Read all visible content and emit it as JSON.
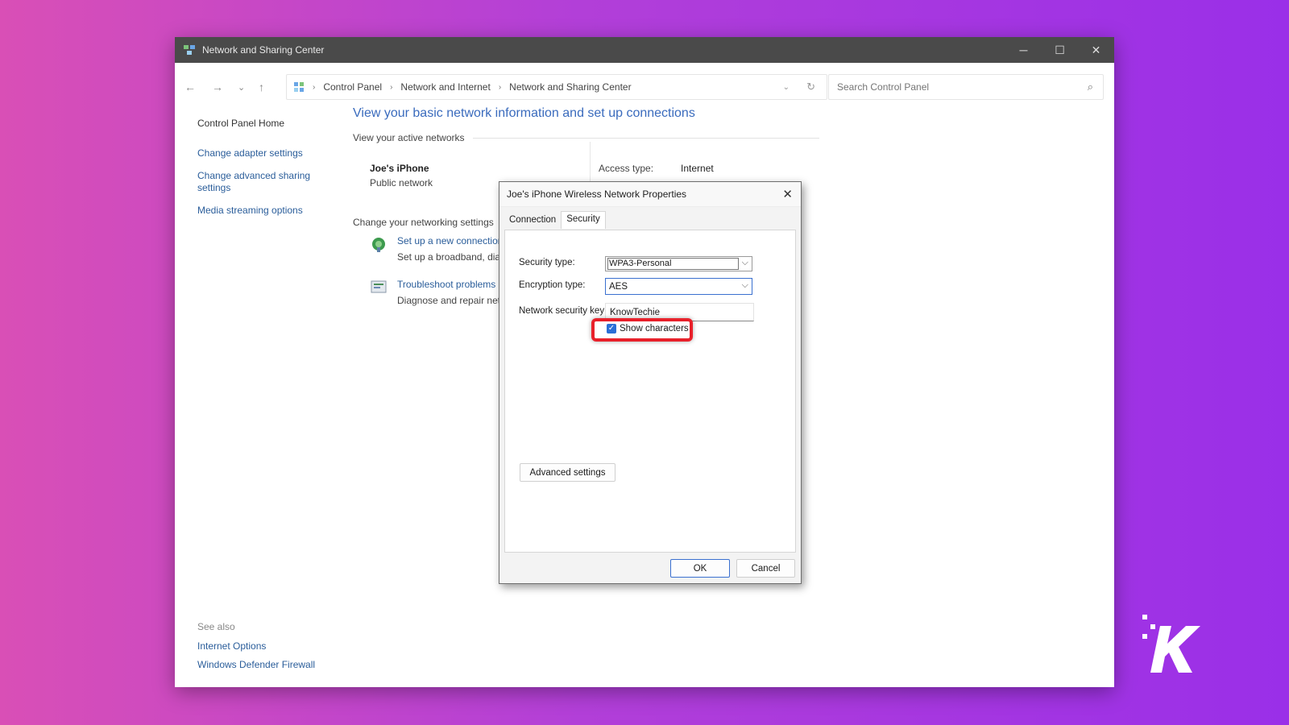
{
  "window": {
    "title": "Network and Sharing Center",
    "controls": {
      "minimize": "─",
      "maximize": "☐",
      "close": "✕"
    }
  },
  "navbar": {
    "back": "←",
    "forward": "→",
    "recent": "⌄",
    "up": "↑",
    "breadcrumbs": [
      "Control Panel",
      "Network and Internet",
      "Network and Sharing Center"
    ],
    "search_placeholder": "Search Control Panel"
  },
  "leftnav": {
    "home": "Control Panel Home",
    "links": [
      "Change adapter settings",
      "Change advanced sharing settings",
      "Media streaming options"
    ],
    "see_also_header": "See also",
    "see_also": [
      "Internet Options",
      "Windows Defender Firewall"
    ]
  },
  "main": {
    "heading": "View your basic network information and set up connections",
    "active_networks": "View your active networks",
    "network_name": "Joe's iPhone",
    "network_kind": "Public network",
    "access_type_label": "Access type:",
    "access_type_value": "Internet",
    "change_settings": "Change your networking settings",
    "tasks": [
      {
        "link": "Set up a new connection or network",
        "desc": "Set up a broadband, dial-up, or VPN connection"
      },
      {
        "link": "Troubleshoot problems",
        "desc": "Diagnose and repair network problems"
      }
    ]
  },
  "dialog": {
    "title": "Joe's iPhone Wireless Network Properties",
    "tabs": [
      "Connection",
      "Security"
    ],
    "active_tab": "Security",
    "security_type_label": "Security type:",
    "security_type_value": "WPA3-Personal",
    "encryption_type_label": "Encryption type:",
    "encryption_type_value": "AES",
    "key_label": "Network security key",
    "key_value": "KnowTechie",
    "show_characters": "Show characters",
    "show_characters_checked": true,
    "advanced_button": "Advanced settings",
    "ok": "OK",
    "cancel": "Cancel"
  },
  "colors": {
    "accent": "#2b6fd6",
    "highlight": "#e8202a",
    "link": "#2a5d9a",
    "titlebar": "#4a4a4a"
  }
}
